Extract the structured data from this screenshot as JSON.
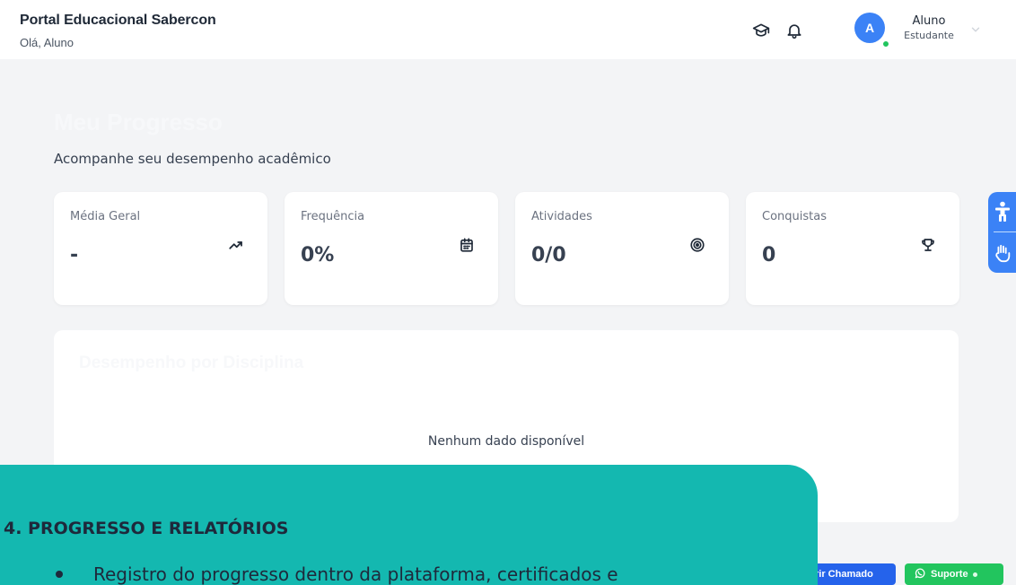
{
  "header": {
    "title": "Portal Educacional Sabercon",
    "greeting": "Olá, Aluno",
    "user": {
      "avatar_initial": "A",
      "name": "Aluno",
      "role": "Estudante"
    },
    "icons": [
      "graduation-cap-icon",
      "bell-icon",
      "chevron-down-icon"
    ]
  },
  "page": {
    "title": "Meu Progresso",
    "subtitle": "Acompanhe seu desempenho acadêmico"
  },
  "stats": [
    {
      "label": "Média Geral",
      "value": "-",
      "icon": "trending-up-icon"
    },
    {
      "label": "Frequência",
      "value": "0%",
      "icon": "calendar-icon"
    },
    {
      "label": "Atividades",
      "value": "0/0",
      "icon": "target-icon"
    },
    {
      "label": "Conquistas",
      "value": "0",
      "icon": "trophy-icon"
    }
  ],
  "performance": {
    "title": "Desempenho por Disciplina",
    "empty_text": "Nenhum dado disponível"
  },
  "accessibility": {
    "icons": [
      "accessibility-person-icon",
      "sign-language-hand-icon"
    ]
  },
  "footer_buttons": {
    "ticket_label": "rir Chamado",
    "support_label": "Suporte"
  },
  "overlay": {
    "heading": "4.   PROGRESSO E RELATÓRIOS",
    "bullet": "Registro do progresso dentro da plataforma, certificados e"
  },
  "colors": {
    "primary": "#3b82f6",
    "success": "#22c55e",
    "overlay_teal": "#14b8b0",
    "background": "#f3f4f6"
  }
}
